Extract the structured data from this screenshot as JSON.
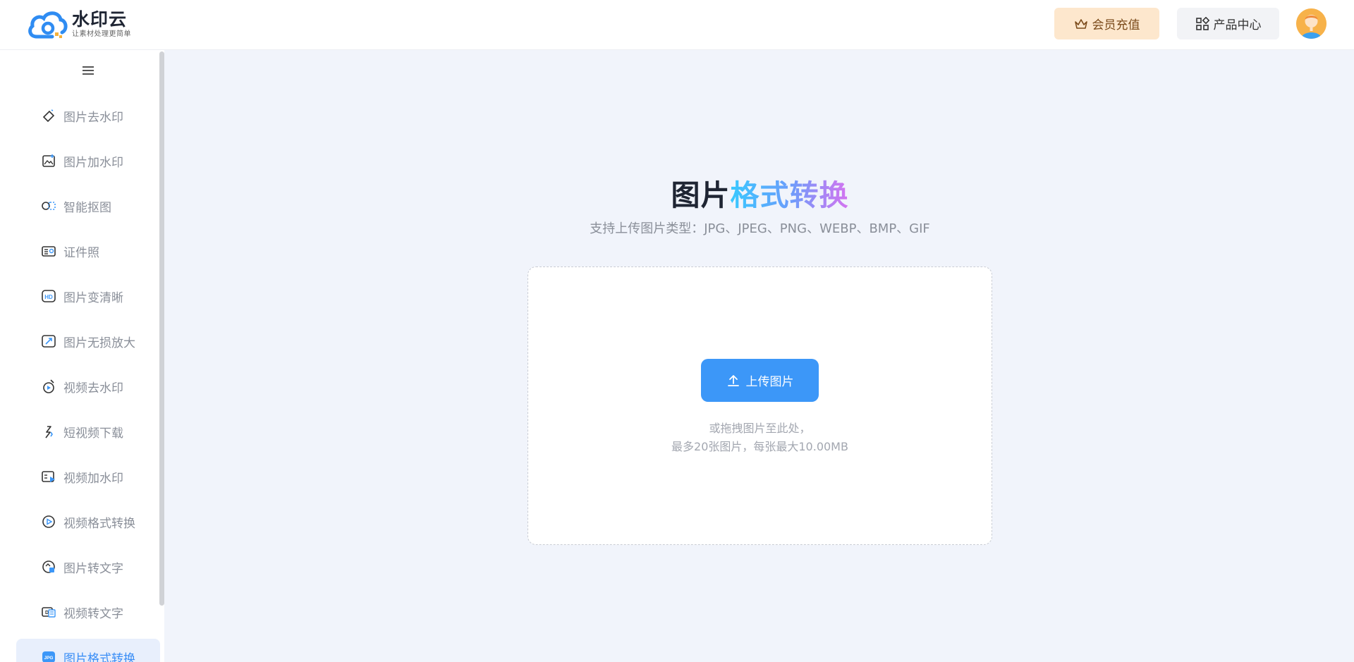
{
  "brand": {
    "name": "水印云",
    "slogan": "让素材处理更简单"
  },
  "header": {
    "vip_label": "会员充值",
    "products_label": "产品中心"
  },
  "sidebar": {
    "items": [
      {
        "label": "图片去水印",
        "icon": "eraser-icon"
      },
      {
        "label": "图片加水印",
        "icon": "image-add-icon"
      },
      {
        "label": "智能抠图",
        "icon": "cutout-icon"
      },
      {
        "label": "证件照",
        "icon": "id-card-icon"
      },
      {
        "label": "图片变清晰",
        "icon": "hd-icon"
      },
      {
        "label": "图片无损放大",
        "icon": "enlarge-icon"
      },
      {
        "label": "视频去水印",
        "icon": "video-eraser-icon"
      },
      {
        "label": "短视频下载",
        "icon": "link-download-icon"
      },
      {
        "label": "视频加水印",
        "icon": "video-add-icon"
      },
      {
        "label": "视频格式转换",
        "icon": "video-convert-icon"
      },
      {
        "label": "图片转文字",
        "icon": "image-ocr-icon"
      },
      {
        "label": "视频转文字",
        "icon": "video-ocr-icon"
      },
      {
        "label": "图片格式转换",
        "icon": "jpg-icon",
        "active": true
      }
    ]
  },
  "main": {
    "title_part1": "图片",
    "title_part2": "格式转换",
    "subtitle": "支持上传图片类型：JPG、JPEG、PNG、WEBP、BMP、GIF",
    "upload_label": "上传图片",
    "hint_line1": "或拖拽图片至此处，",
    "hint_line2": "最多20张图片，每张最大10.00MB"
  },
  "colors": {
    "accent": "#3c97f8",
    "vip_bg": "#fde7cd",
    "page_bg": "#f1f4fb"
  }
}
